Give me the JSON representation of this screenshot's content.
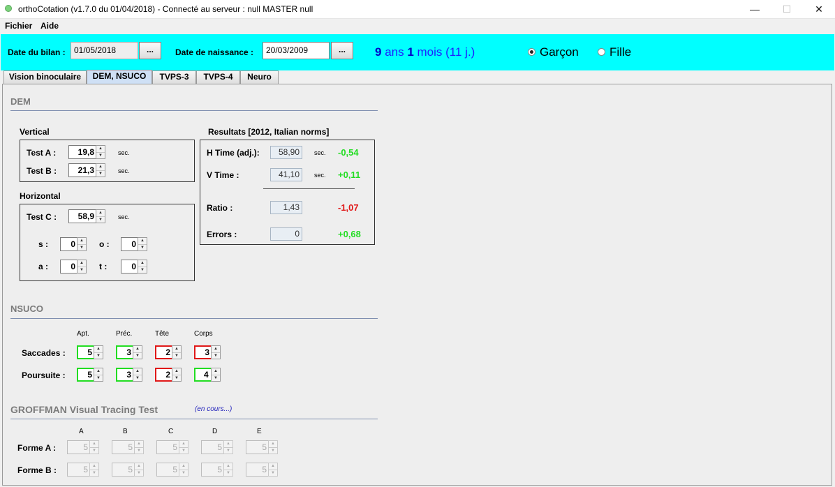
{
  "window": {
    "title": "orthoCotation (v1.7.0 du 01/04/2018) - Connecté au serveur : null MASTER null",
    "minimize": "—",
    "maximize": "☐",
    "close": "✕"
  },
  "menu": {
    "file": "Fichier",
    "help": "Aide"
  },
  "datebar": {
    "bilan_label": "Date du bilan :",
    "bilan_value": "01/05/2018",
    "birth_label": "Date de naissance :",
    "birth_value": "20/03/2009",
    "dots": "...",
    "age_years": "9",
    "age_years_unit": " ans ",
    "age_months": "1",
    "age_rest": " mois (11 j.)",
    "gender_boy": "Garçon",
    "gender_girl": "Fille",
    "selected_gender": "Garçon",
    "bg_color": "#00ffff"
  },
  "tabs": [
    {
      "label": "Vision binoculaire",
      "active": false
    },
    {
      "label": "DEM, NSUCO",
      "active": true
    },
    {
      "label": "TVPS-3",
      "active": false
    },
    {
      "label": "TVPS-4",
      "active": false
    },
    {
      "label": "Neuro",
      "active": false
    }
  ],
  "dem": {
    "title": "DEM",
    "vertical_title": "Vertical",
    "test_a_label": "Test A :",
    "test_a_value": "19,8",
    "test_b_label": "Test B :",
    "test_b_value": "21,3",
    "horizontal_title": "Horizontal",
    "test_c_label": "Test C :",
    "test_c_value": "58,9",
    "sec": "sec.",
    "s_label": "s :",
    "s_value": "0",
    "o_label": "o :",
    "o_value": "0",
    "a_label": "a :",
    "a_value": "0",
    "t_label": "t :",
    "t_value": "0",
    "results_title": "Resultats [2012, Italian norms]",
    "htime_label": "H Time (adj.):",
    "htime_value": "58,90",
    "htime_score": "-0,54",
    "vtime_label": "V Time :",
    "vtime_value": "41,10",
    "vtime_score": "+0,11",
    "ratio_label": "Ratio :",
    "ratio_value": "1,43",
    "ratio_score": "-1,07",
    "errors_label": "Errors :",
    "errors_value": "0",
    "errors_score": "+0,68"
  },
  "nsuco": {
    "title": "NSUCO",
    "columns": [
      "Apt.",
      "Préc.",
      "Tête",
      "Corps"
    ],
    "saccades_label": "Saccades :",
    "saccades": [
      "5",
      "3",
      "2",
      "3"
    ],
    "poursuite_label": "Poursuite :",
    "poursuite": [
      "5",
      "3",
      "2",
      "4"
    ],
    "good_color": "#22dd22",
    "bad_color": "#e01818"
  },
  "groffman": {
    "title": "GROFFMAN Visual Tracing Test",
    "status": "(en cours...)",
    "columns": [
      "A",
      "B",
      "C",
      "D",
      "E"
    ],
    "forme_a_label": "Forme A :",
    "forme_a": [
      "5",
      "5",
      "5",
      "5",
      "5"
    ],
    "forme_b_label": "Forme B :",
    "forme_b": [
      "5",
      "5",
      "5",
      "5",
      "5"
    ]
  }
}
